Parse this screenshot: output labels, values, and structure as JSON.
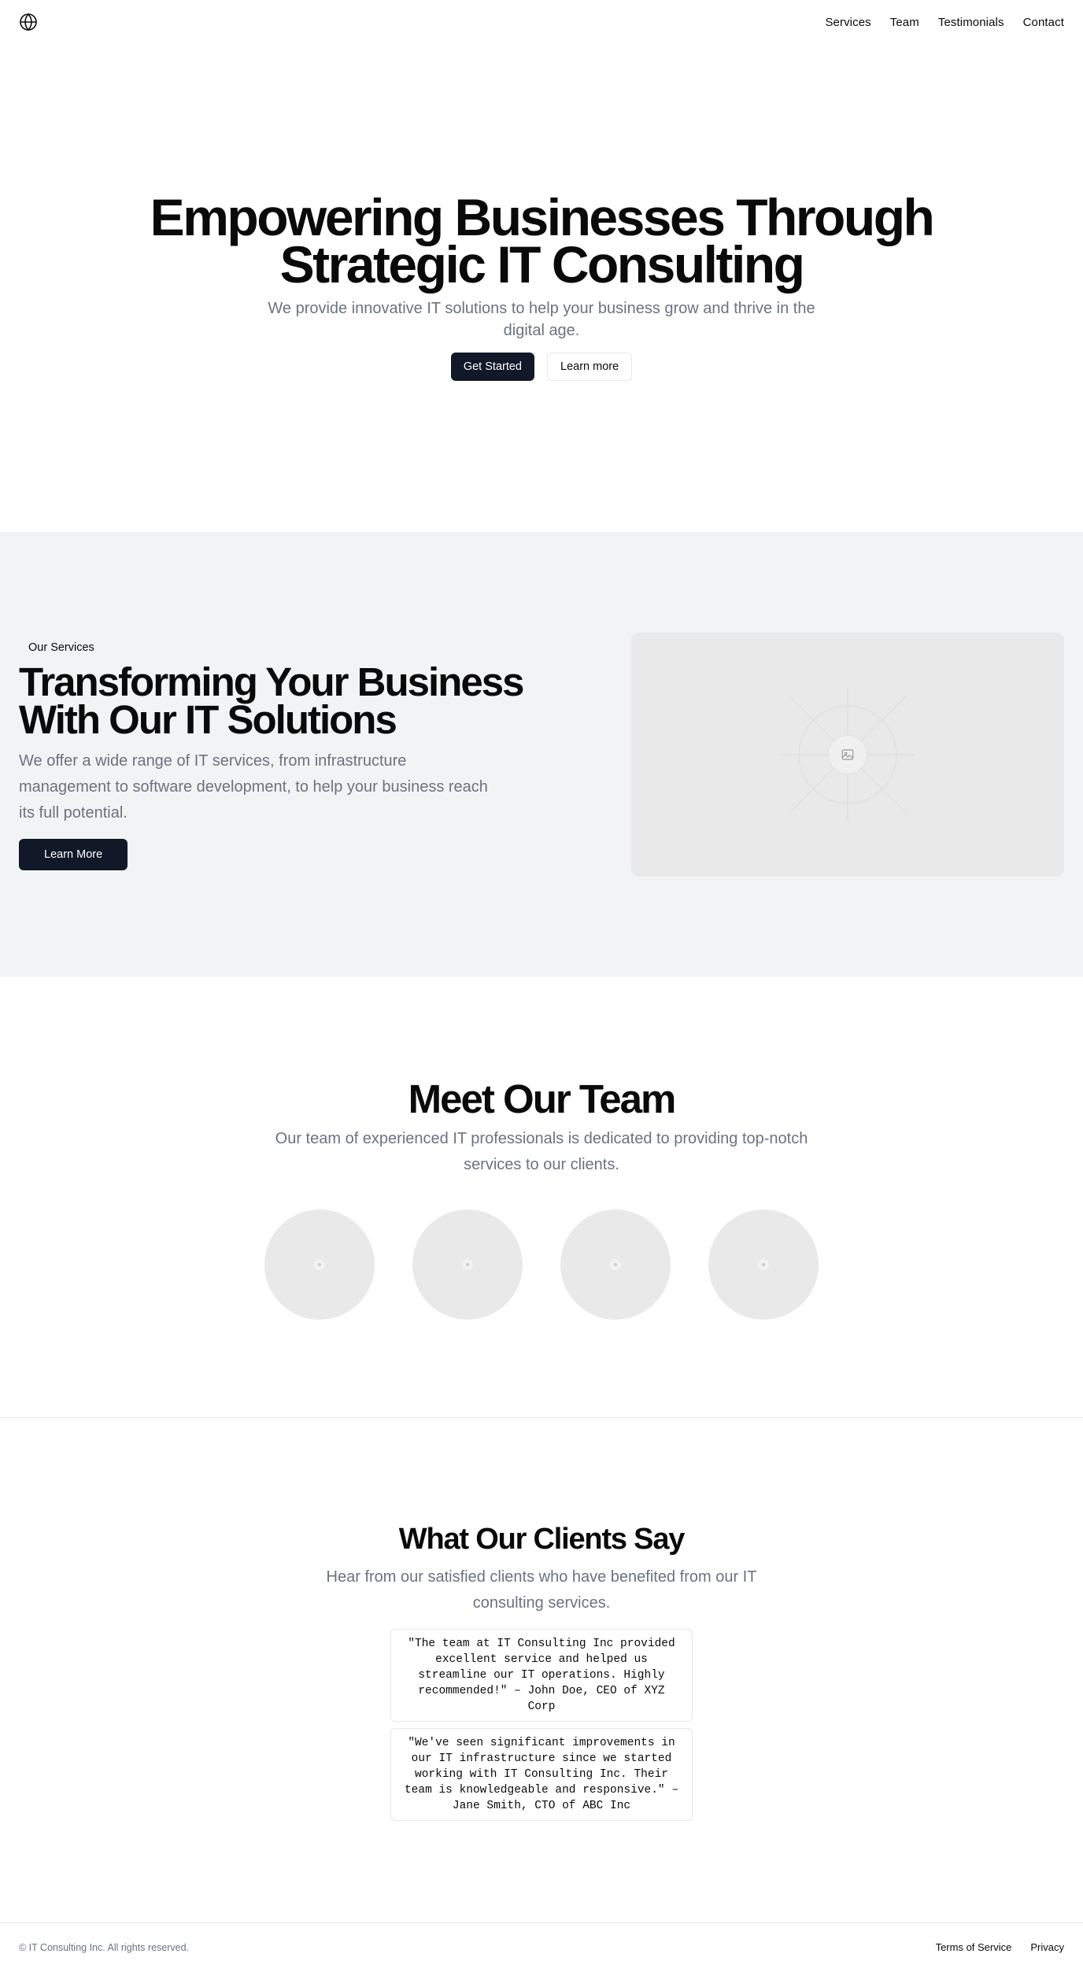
{
  "header": {
    "logo_icon": "globe-icon",
    "nav": [
      {
        "label": "Services"
      },
      {
        "label": "Team"
      },
      {
        "label": "Testimonials"
      },
      {
        "label": "Contact"
      }
    ]
  },
  "hero": {
    "title": "Empowering Businesses Through Strategic IT Consulting",
    "subtitle": "We provide innovative IT solutions to help your business grow and thrive in the digital age.",
    "primary_button": "Get Started",
    "secondary_button": "Learn more"
  },
  "services": {
    "badge": "Our Services",
    "title": "Transforming Your Business With Our IT Solutions",
    "description": "We offer a wide range of IT services, from infrastructure management to software development, to help your business reach its full potential.",
    "button": "Learn More",
    "image_icon": "image-placeholder-icon"
  },
  "team": {
    "title": "Meet Our Team",
    "subtitle": "Our team of experienced IT professionals is dedicated to providing top-notch services to our clients.",
    "members": 4
  },
  "testimonials": {
    "title": "What Our Clients Say",
    "subtitle": "Hear from our satisfied clients who have benefited from our IT consulting services.",
    "quotes": [
      {
        "text": "\"The team at IT Consulting Inc provided excellent service and helped us streamline our IT operations. Highly recommended!\" – John Doe, CEO of XYZ Corp"
      },
      {
        "text": "\"We've seen significant improvements in our IT infrastructure since we started working with IT Consulting Inc. Their team is knowledgeable and responsive.\" – Jane Smith, CTO of ABC Inc"
      }
    ]
  },
  "footer": {
    "copyright": "© IT Consulting Inc. All rights reserved.",
    "links": [
      {
        "label": "Terms of Service"
      },
      {
        "label": "Privacy"
      }
    ]
  },
  "colors": {
    "primary_button": "#111827",
    "muted_text": "#6b7280",
    "section_bg": "#f2f3f5",
    "placeholder_bg": "#e9e9e9"
  }
}
